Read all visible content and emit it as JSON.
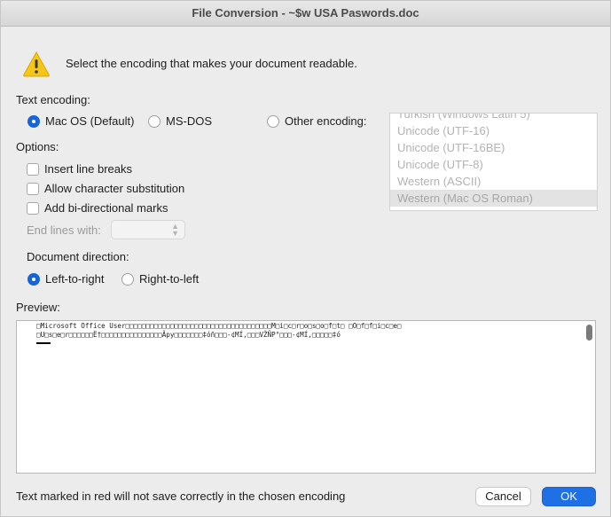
{
  "window": {
    "title": "File Conversion - ~$w USA Paswords.doc"
  },
  "message": "Select the encoding that makes your document readable.",
  "text_encoding": {
    "label": "Text encoding:",
    "options": [
      "Mac OS (Default)",
      "MS-DOS",
      "Other encoding:"
    ],
    "selected": "Mac OS (Default)"
  },
  "encoding_list": {
    "items": [
      "Turkish (Windows Latin 5)",
      "Unicode (UTF-16)",
      "Unicode (UTF-16BE)",
      "Unicode (UTF-8)",
      "Western (ASCII)",
      "Western (Mac OS Roman)"
    ],
    "selected": "Western (Mac OS Roman)"
  },
  "options": {
    "label": "Options:",
    "checkboxes": [
      "Insert line breaks",
      "Allow character substitution",
      "Add bi-directional marks"
    ],
    "end_lines_label": "End lines with:",
    "end_lines_value": ""
  },
  "direction": {
    "label": "Document direction:",
    "options": [
      "Left-to-right",
      "Right-to-left"
    ],
    "selected": "Left-to-right"
  },
  "preview": {
    "label": "Preview:",
    "line1": "□Microsoft Office User□□□□□□□□□□□□□□□□□□□□□□□□□□□□□□□□□□□□M□i□c□r□o□s□o□f□t□ □O□f□f□i□c□e□",
    "line2": "□U□s□e□r□□□□□□Ë†□□□□□□□□□□□□□□□Ãpy□□□□□□□‡óñ□□□-¢MÍ,□□□VŽÑP°□□□-¢MÍ,□□□□□‡ó"
  },
  "footer": {
    "note": "Text marked in red will not save correctly in the chosen encoding",
    "cancel_label": "Cancel",
    "ok_label": "OK"
  },
  "colors": {
    "accent": "#1f6fe5",
    "warning": "#f5c518"
  },
  "icons": [
    "warning-icon",
    "chevron-updown-icon"
  ]
}
